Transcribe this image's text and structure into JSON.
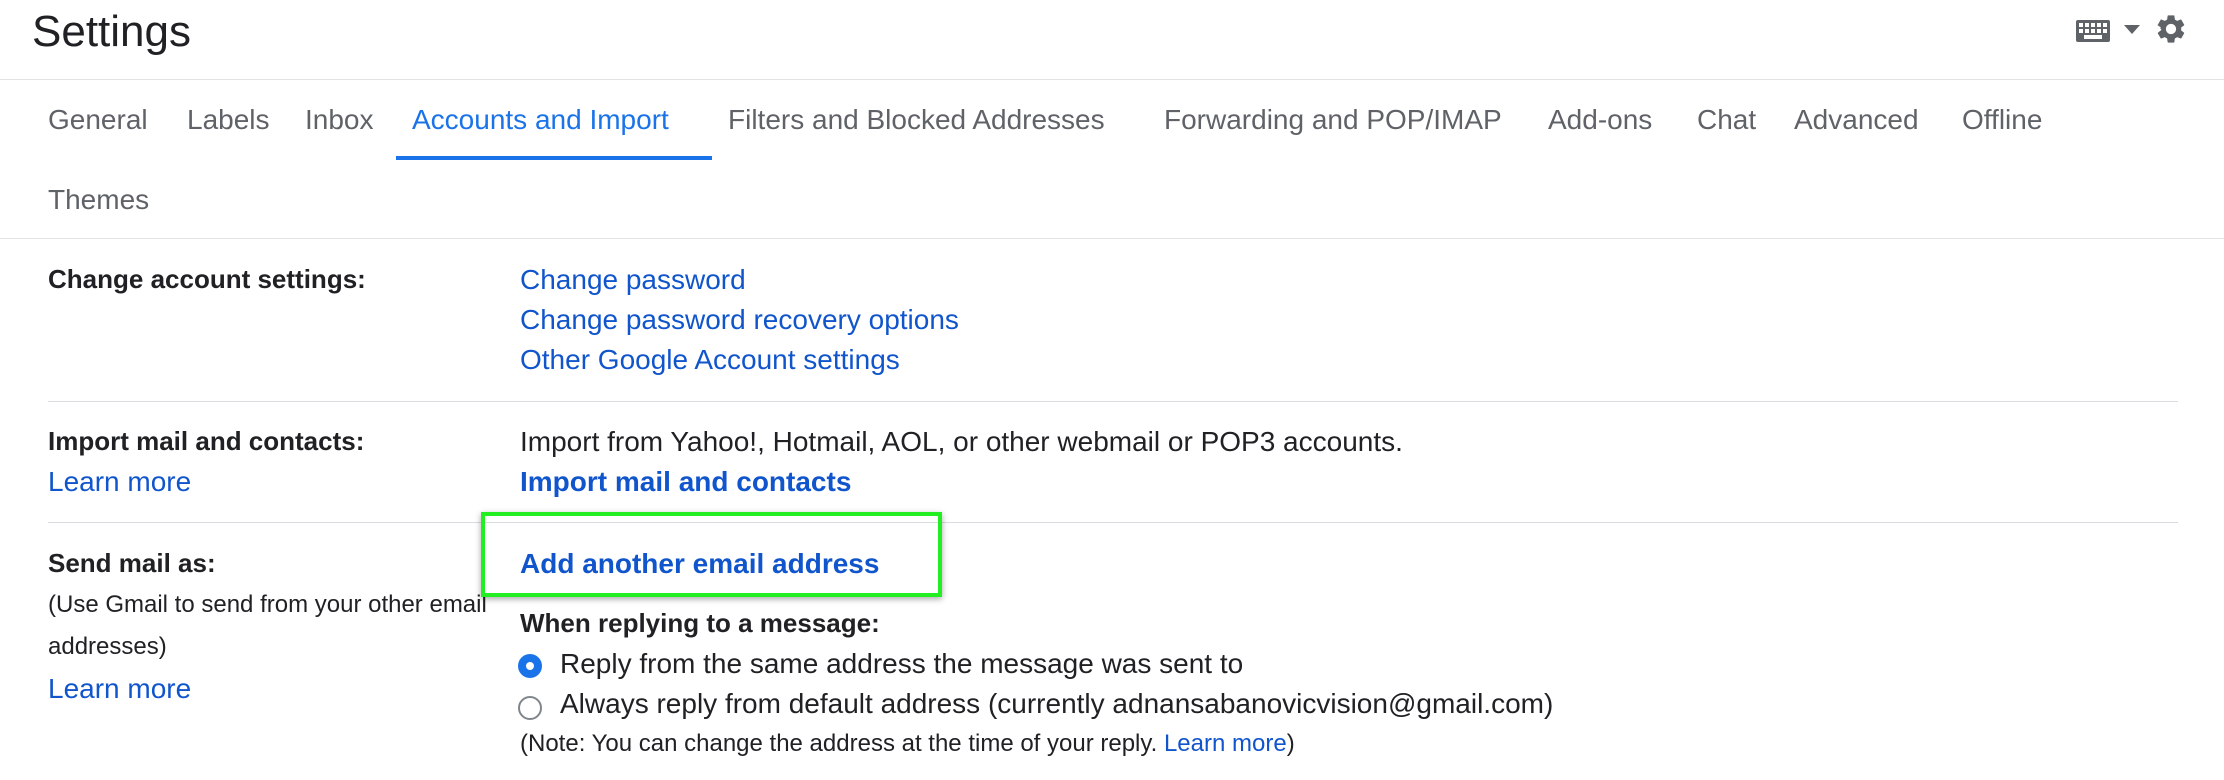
{
  "header": {
    "title": "Settings",
    "keyboard_icon": "keyboard-icon",
    "dropdown_icon": "caret-down-icon",
    "settings_icon": "gear-icon"
  },
  "tabs": [
    {
      "label": "General"
    },
    {
      "label": "Labels"
    },
    {
      "label": "Inbox"
    },
    {
      "label": "Accounts and Import",
      "active": true
    },
    {
      "label": "Filters and Blocked Addresses"
    },
    {
      "label": "Forwarding and POP/IMAP"
    },
    {
      "label": "Add-ons"
    },
    {
      "label": "Chat"
    },
    {
      "label": "Advanced"
    },
    {
      "label": "Offline"
    },
    {
      "label": "Themes"
    }
  ],
  "sections": {
    "change_account": {
      "label": "Change account settings:",
      "links": [
        "Change password",
        "Change password recovery options",
        "Other Google Account settings"
      ]
    },
    "import": {
      "label": "Import mail and contacts:",
      "learn_more": "Learn more",
      "description": "Import from Yahoo!, Hotmail, AOL, or other webmail or POP3 accounts.",
      "action": "Import mail and contacts"
    },
    "send_mail_as": {
      "label": "Send mail as:",
      "sub_line1": "(Use Gmail to send from your other email",
      "sub_line2": "addresses)",
      "learn_more": "Learn more",
      "action": "Add another email address",
      "replying_heading": "When replying to a message:",
      "options": [
        {
          "label": "Reply from the same address the message was sent to",
          "selected": true
        },
        {
          "label": "Always reply from default address (currently adnansabanovicvision@gmail.com)",
          "selected": false
        }
      ],
      "note_prefix": "(Note: You can change the address at the time of your reply. ",
      "note_link": "Learn more",
      "note_suffix": ")"
    }
  },
  "colors": {
    "accent": "#1a73e8",
    "link": "#1155cc",
    "highlight": "#22ee22"
  }
}
